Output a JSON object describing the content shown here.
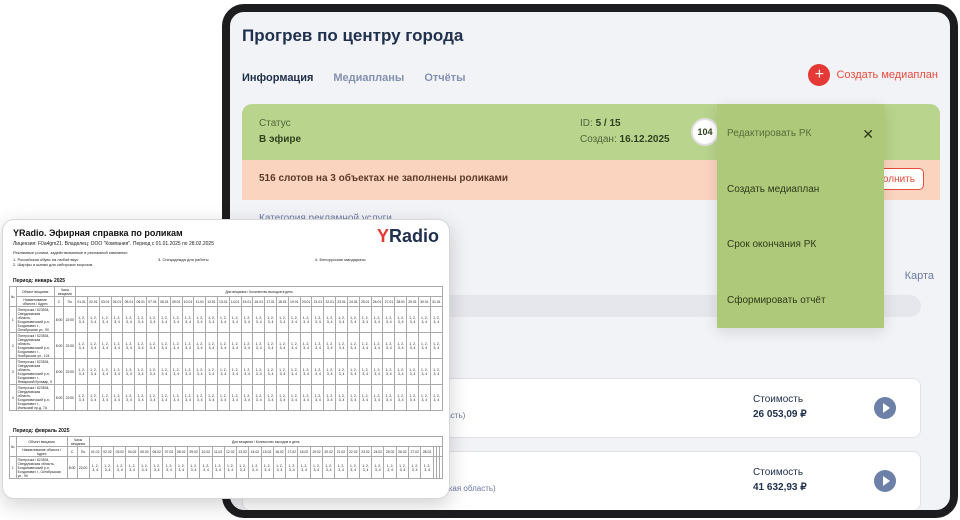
{
  "campaign": {
    "title": "Прогрев по центру города",
    "tabs": [
      {
        "label": "Информация",
        "active": true
      },
      {
        "label": "Медиапланы",
        "active": false
      },
      {
        "label": "Отчёты",
        "active": false
      }
    ],
    "create_media_plan": "Создать медиаплан",
    "status": {
      "label": "Статус",
      "value": "В эфире",
      "id_label": "ID:",
      "id_value": "5 / 15",
      "created_label": "Создан:",
      "created_value": "16.12.2025",
      "badge": "104"
    },
    "warning": {
      "text": "516 слотов на 3 объектах не заполнены роликами",
      "button": "олнить"
    },
    "category_label": "Категория рекламной услуги",
    "map_link": "Карта",
    "items": [
      {
        "address_suffix": "область)",
        "cost_label": "Стоимость",
        "cost": "26 053,09 ₽"
      },
      {
        "address_suffix": "Омская область)",
        "cost_label": "Стоимость",
        "cost": "41 632,93 ₽"
      }
    ]
  },
  "context_menu": {
    "title": "Редактировать РК",
    "items": [
      "Создать медиаплан",
      "Срок окончания РК",
      "Сформировать отчёт"
    ]
  },
  "document": {
    "title": "YRadio. Эфирная справка по роликам",
    "license": "Лицензия: F0a4gm21. Владелец: ООО \"Компания\". Период с 01.01.2025 по 28.02.2025",
    "note": "Рекламные ролики, задействованные в рекламной кампании:",
    "categories": [
      "1. Российская обувь на любой вкус",
      "2. Шарфы и шапки для сибирских морозов",
      "3. Спецодежда для работы",
      "4. Белорусские мандарины"
    ],
    "logo_main": "Y",
    "logo_rest": "Radio",
    "periods": [
      {
        "title": "Период: январь 2025",
        "days": [
          "01.01",
          "02.01",
          "03.01",
          "04.01",
          "05.01",
          "06.01",
          "07.01",
          "08.01",
          "09.01",
          "10.01",
          "11.01",
          "12.01",
          "13.01",
          "14.01",
          "15.01",
          "16.01",
          "17.01",
          "18.01",
          "19.01",
          "20.01",
          "21.01",
          "22.01",
          "23.01",
          "24.01",
          "25.01",
          "26.01",
          "27.01",
          "28.01",
          "29.01",
          "30.01",
          "31.01"
        ],
        "rows": [
          {
            "n": "1",
            "address": "Пятерочка / 623534, Свердловская область, Богдановичский р-н, Богданович г., Октябрьская ул., 90",
            "from": "8:00",
            "to": "22:00"
          },
          {
            "n": "2",
            "address": "Пятерочка / 623534, Свердловская область, Богдановичский р-н, Богданович г., Ноябрьская ул., 124",
            "from": "8:00",
            "to": "22:00"
          },
          {
            "n": "3",
            "address": "Пятерочка / 623534, Свердловская область, Богдановичский р-н, Богданович г., Январский бульвар, 5",
            "from": "8:00",
            "to": "22:00"
          },
          {
            "n": "4",
            "address": "Пятерочка / 623534, Свердловская область, Богдановичский р-н, Богданович г., Июньский пр-д, 7А",
            "from": "8:00",
            "to": "22:00"
          }
        ]
      },
      {
        "title": "Период: февраль 2025",
        "days": [
          "01.02",
          "02.02",
          "03.02",
          "04.02",
          "05.02",
          "06.02",
          "07.02",
          "08.02",
          "09.02",
          "10.02",
          "11.02",
          "12.02",
          "13.02",
          "14.02",
          "15.02",
          "16.02",
          "17.02",
          "18.02",
          "19.02",
          "20.02",
          "21.02",
          "22.02",
          "23.02",
          "24.02",
          "25.02",
          "26.02",
          "27.02",
          "28.02"
        ],
        "rows": [
          {
            "n": "1",
            "address": "Пятерочка / 623534, Свердловская область, Богдановичский р-н, Богданович г., Октябрьская ул., 90",
            "from": "8:00",
            "to": "22:00"
          }
        ]
      }
    ],
    "headers": {
      "n": "№",
      "object": "Объект вещания",
      "name_address": "Наименование объекта / Адрес",
      "hours": "Часы вещания",
      "from": "С",
      "to": "По",
      "days": "Дни вещания / Количество выходов в день"
    },
    "cell_value": "1, 2, 3, 4"
  }
}
